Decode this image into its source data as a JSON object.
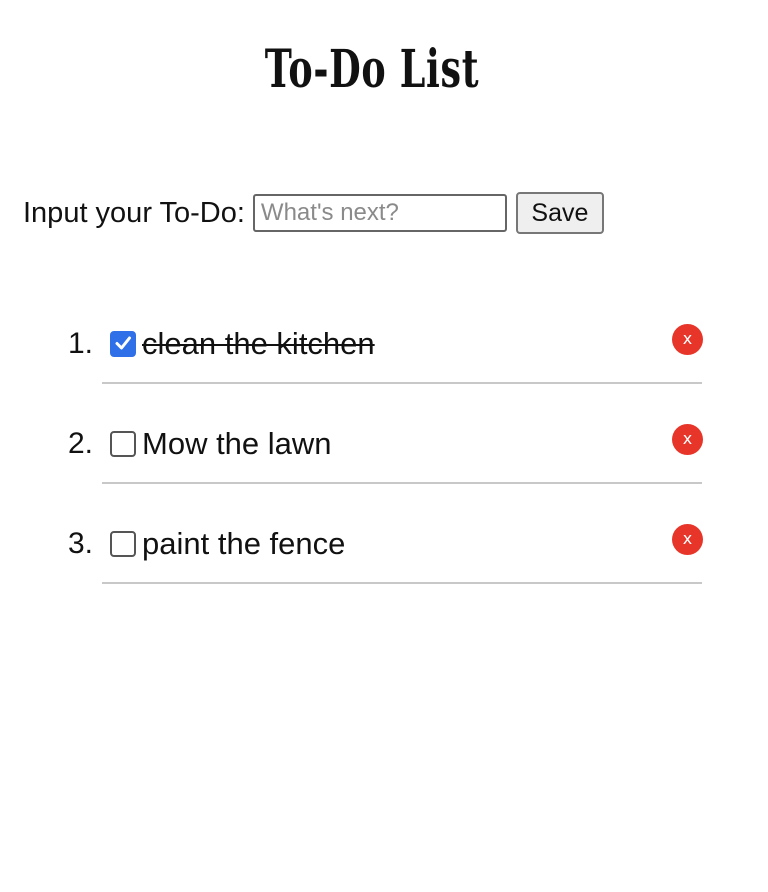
{
  "page": {
    "title": "To-Do List"
  },
  "input_row": {
    "label": "Input your To-Do:",
    "placeholder": "What's next?",
    "value": "",
    "save_label": "Save"
  },
  "todos": [
    {
      "number": "1.",
      "text": "clean the kitchen",
      "done": true,
      "delete_label": "x"
    },
    {
      "number": "2.",
      "text": "Mow the lawn",
      "done": false,
      "delete_label": "x"
    },
    {
      "number": "3.",
      "text": "paint the fence",
      "done": false,
      "delete_label": "x"
    }
  ],
  "colors": {
    "checkbox_checked": "#2f6fe8",
    "delete_button": "#e8352a",
    "divider": "#c8c8c8"
  }
}
